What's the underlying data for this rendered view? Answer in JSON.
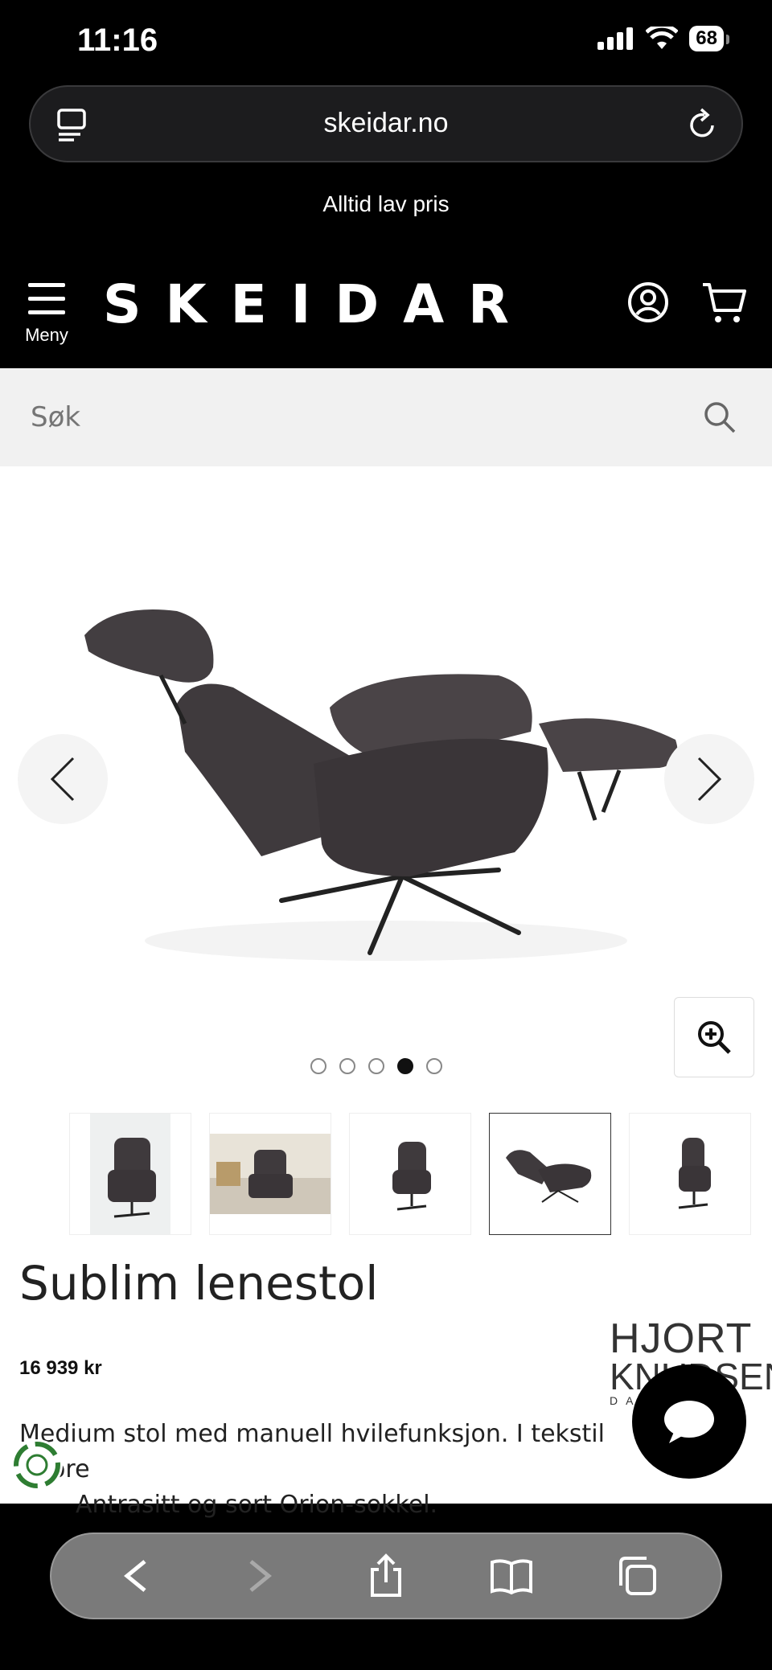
{
  "status": {
    "time": "11:16",
    "battery": "68"
  },
  "browser": {
    "url": "skeidar.no"
  },
  "promo": "Alltid lav pris",
  "header": {
    "menu_label": "Meny",
    "logo": "SKEIDAR"
  },
  "search": {
    "placeholder": "Søk"
  },
  "gallery": {
    "total_images": 5,
    "active_index": 4
  },
  "product": {
    "title": "Sublim lenestol",
    "price": "16 939 kr",
    "brand_line1": "HJORT",
    "brand_line2": "KNUDSEN",
    "brand_line3": "DANMARK",
    "description_line1": "Medium stol med manuell hvilefunksjon. I tekstil Adore",
    "description_line2": "Antrasitt og sort Orion-sokkel."
  },
  "colors": {
    "black": "#000000",
    "search_bg": "#f1f1f1",
    "toolbar": "#7a7a7a"
  }
}
